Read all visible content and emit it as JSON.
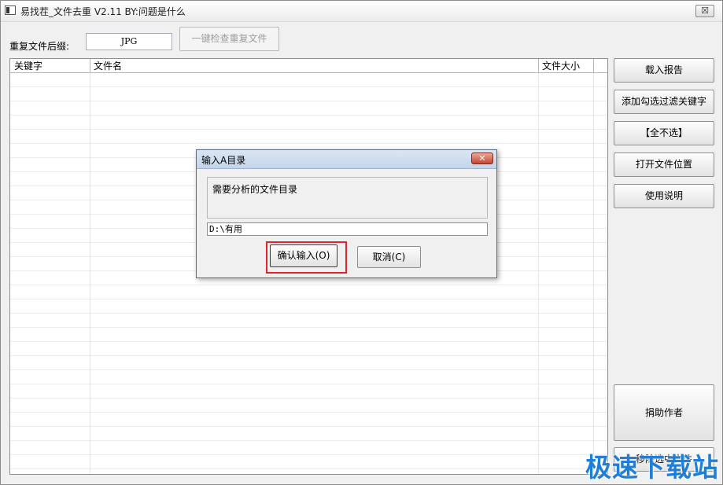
{
  "window": {
    "title": "易找茬_文件去重 V2.11   BY:问题是什么",
    "close_label": "☒"
  },
  "toolbar": {
    "suffix_label": "重复文件后缀:",
    "suffix_value": "JPG",
    "check_button": "一键检查重复文件"
  },
  "list": {
    "columns": [
      "关键字",
      "文件名",
      "文件大小"
    ]
  },
  "side_buttons": {
    "load_report": "载入报告",
    "add_filter_keyword": "添加勾选过滤关键字",
    "select_none": "【全不选】",
    "open_location": "打开文件位置",
    "instructions": "使用说明",
    "donate": "捐助作者",
    "move_selected": "移除选中文件"
  },
  "dialog": {
    "title": "输入A目录",
    "close_label": "✕",
    "prompt": "需要分析的文件目录",
    "input_value": "D:\\有用",
    "ok_button": "确认输入(O)",
    "cancel_button": "取消(C)"
  },
  "watermark": "极速下载站",
  "colors": {
    "highlight": "#e0262b",
    "watermark": "#1f7fd8"
  }
}
